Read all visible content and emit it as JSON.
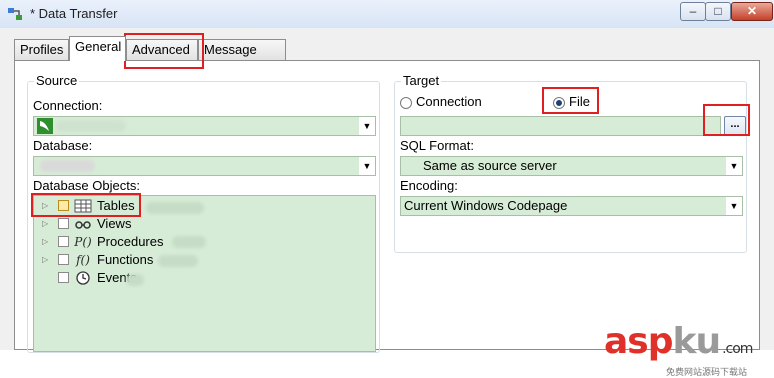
{
  "window": {
    "title": "* Data Transfer",
    "min_glyph": "–",
    "max_glyph": "□",
    "close_glyph": "✕"
  },
  "tabs": [
    {
      "label": "Profiles",
      "active": false
    },
    {
      "label": "General",
      "active": true
    },
    {
      "label": "Advanced",
      "active": false
    },
    {
      "label": "Message Log",
      "active": false
    }
  ],
  "source": {
    "title": "Source",
    "connection_label": "Connection:",
    "database_label": "Database:",
    "objects_label": "Database Objects:",
    "objects": [
      {
        "label": "Tables",
        "icon": "table-icon"
      },
      {
        "label": "Views",
        "icon": "view-icon"
      },
      {
        "label": "Procedures",
        "icon": "procedure-icon"
      },
      {
        "label": "Functions",
        "icon": "function-icon"
      },
      {
        "label": "Events",
        "icon": "event-clock-icon"
      }
    ]
  },
  "target": {
    "title": "Target",
    "radio_connection": "Connection",
    "radio_file": "File",
    "selected": "File",
    "browse_label": "...",
    "sql_format_label": "SQL Format:",
    "sql_format_value": "Same as source server",
    "encoding_label": "Encoding:",
    "encoding_value": "Current Windows Codepage"
  },
  "watermark": {
    "main": "asp",
    "accent": "ku",
    "suffix": ".com",
    "sub": "免费网站源码下载站"
  },
  "colors": {
    "field_bg": "#d7ecd7",
    "highlight": "#e02020",
    "watermark_red": "#e0302a"
  }
}
